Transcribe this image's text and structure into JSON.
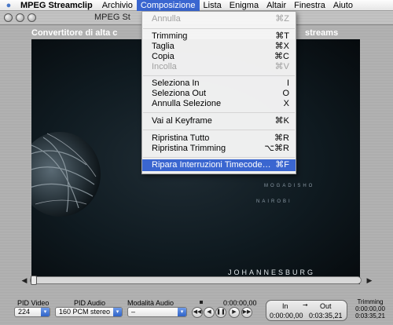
{
  "menubar": {
    "app_name": "MPEG Streamclip",
    "items": [
      "Archivio",
      "Composizione",
      "Lista",
      "Enigma",
      "Altair",
      "Finestra",
      "Aiuto"
    ]
  },
  "window": {
    "title": "MPEG St",
    "subtitle": "Convertitore di alta c",
    "subtitle_right": "streams"
  },
  "video": {
    "cities": [
      "MOGADISHO",
      "NAIROBI",
      "JOHANNESBURG"
    ]
  },
  "dropdown": {
    "items": [
      {
        "label": "Annulla",
        "shortcut": "⌘Z",
        "enabled": false
      },
      {
        "label": "Trimming",
        "shortcut": "⌘T",
        "enabled": true
      },
      {
        "label": "Taglia",
        "shortcut": "⌘X",
        "enabled": true
      },
      {
        "label": "Copia",
        "shortcut": "⌘C",
        "enabled": true
      },
      {
        "label": "Incolla",
        "shortcut": "⌘V",
        "enabled": false
      },
      {
        "label": "Seleziona In",
        "shortcut": "I",
        "enabled": true
      },
      {
        "label": "Seleziona Out",
        "shortcut": "O",
        "enabled": true
      },
      {
        "label": "Annulla Selezione",
        "shortcut": "X",
        "enabled": true
      },
      {
        "label": "Vai al Keyframe",
        "shortcut": "⌘K",
        "enabled": true
      },
      {
        "label": "Ripristina Tutto",
        "shortcut": "⌘R",
        "enabled": true
      },
      {
        "label": "Ripristina Trimming",
        "shortcut": "⌥⌘R",
        "enabled": true
      },
      {
        "label": "Ripara Interruzioni Timecode…",
        "shortcut": "⌘F",
        "enabled": true,
        "highlighted": true
      }
    ]
  },
  "controls": {
    "pid_video_label": "PID Video",
    "pid_video_value": "224",
    "pid_audio_label": "PID Audio",
    "pid_audio_value": "160 PCM stereo",
    "audio_mode_label": "Modalità Audio",
    "audio_mode_value": "–",
    "current_time": "0:00:00,00",
    "in_label": "In",
    "out_label": "Out",
    "in_value": "0:00:00,00",
    "out_value": "0:03:35,21",
    "trimming_label": "Trimming",
    "trimming_start": "0:00:00,00",
    "trimming_end": "0:03:35,21"
  }
}
